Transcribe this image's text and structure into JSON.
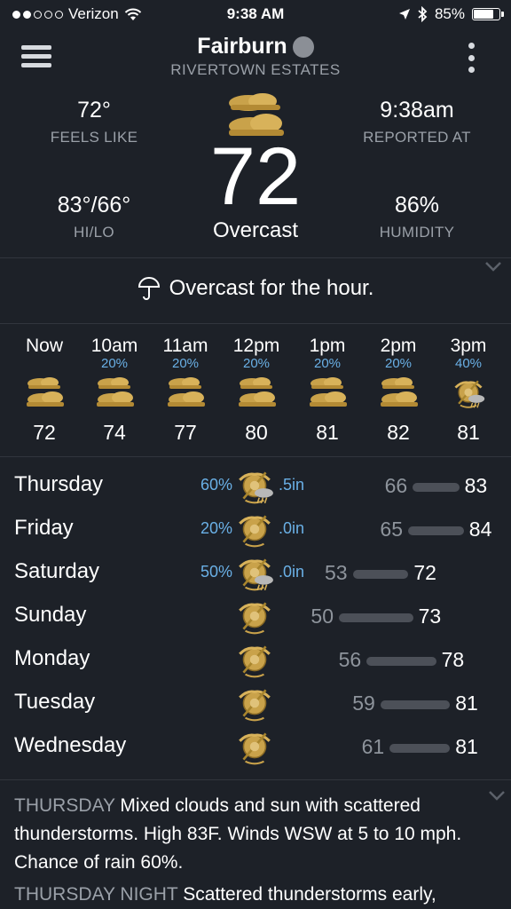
{
  "status": {
    "carrier": "Verizon",
    "time": "9:38 AM",
    "battery": "85%",
    "battery_level": 0.85
  },
  "header": {
    "city": "Fairburn",
    "subtitle": "RIVERTOWN ESTATES"
  },
  "current": {
    "feels_like_value": "72°",
    "feels_like_label": "FEELS LIKE",
    "reported_value": "9:38am",
    "reported_label": "REPORTED AT",
    "hilo_value": "83°/66°",
    "hilo_label": "HI/LO",
    "humidity_value": "86%",
    "humidity_label": "HUMIDITY",
    "temp": "72",
    "condition": "Overcast"
  },
  "hour_summary": {
    "text": "Overcast for the hour."
  },
  "hourly": [
    {
      "time": "Now",
      "pop": "",
      "temp": "72",
      "icon": "cloudy-icon"
    },
    {
      "time": "10am",
      "pop": "20%",
      "temp": "74",
      "icon": "cloudy-icon"
    },
    {
      "time": "11am",
      "pop": "20%",
      "temp": "77",
      "icon": "cloudy-icon"
    },
    {
      "time": "12pm",
      "pop": "20%",
      "temp": "80",
      "icon": "cloudy-icon"
    },
    {
      "time": "1pm",
      "pop": "20%",
      "temp": "81",
      "icon": "cloudy-icon"
    },
    {
      "time": "2pm",
      "pop": "20%",
      "temp": "82",
      "icon": "cloudy-icon"
    },
    {
      "time": "3pm",
      "pop": "40%",
      "temp": "81",
      "icon": "thunderstorm-icon"
    }
  ],
  "daily": [
    {
      "day": "Thursday",
      "pop": "60%",
      "precip": ".5in",
      "lo": "66",
      "hi": "83",
      "icon": "thunderstorm-icon"
    },
    {
      "day": "Friday",
      "pop": "20%",
      "precip": ".0in",
      "lo": "65",
      "hi": "84",
      "icon": "emblem-icon"
    },
    {
      "day": "Saturday",
      "pop": "50%",
      "precip": ".0in",
      "lo": "53",
      "hi": "72",
      "icon": "thunderstorm-icon"
    },
    {
      "day": "Sunday",
      "pop": "",
      "precip": "",
      "lo": "50",
      "hi": "73",
      "icon": "emblem-icon"
    },
    {
      "day": "Monday",
      "pop": "",
      "precip": "",
      "lo": "56",
      "hi": "78",
      "icon": "emblem-icon"
    },
    {
      "day": "Tuesday",
      "pop": "",
      "precip": "",
      "lo": "59",
      "hi": "81",
      "icon": "emblem-icon"
    },
    {
      "day": "Wednesday",
      "pop": "",
      "precip": "",
      "lo": "61",
      "hi": "81",
      "icon": "emblem-icon"
    }
  ],
  "forecast": [
    {
      "period": "THURSDAY",
      "text": " Mixed clouds and sun with scattered thunderstorms. High 83F. Winds WSW at 5 to 10 mph. Chance of rain 60%."
    },
    {
      "period": "THURSDAY NIGHT",
      "text": " Scattered thunderstorms early,"
    }
  ],
  "colors": {
    "background": "#1d2128",
    "accent_blue": "#6ab0e6",
    "muted": "#9aa0a8",
    "bar": "#4c5058"
  }
}
